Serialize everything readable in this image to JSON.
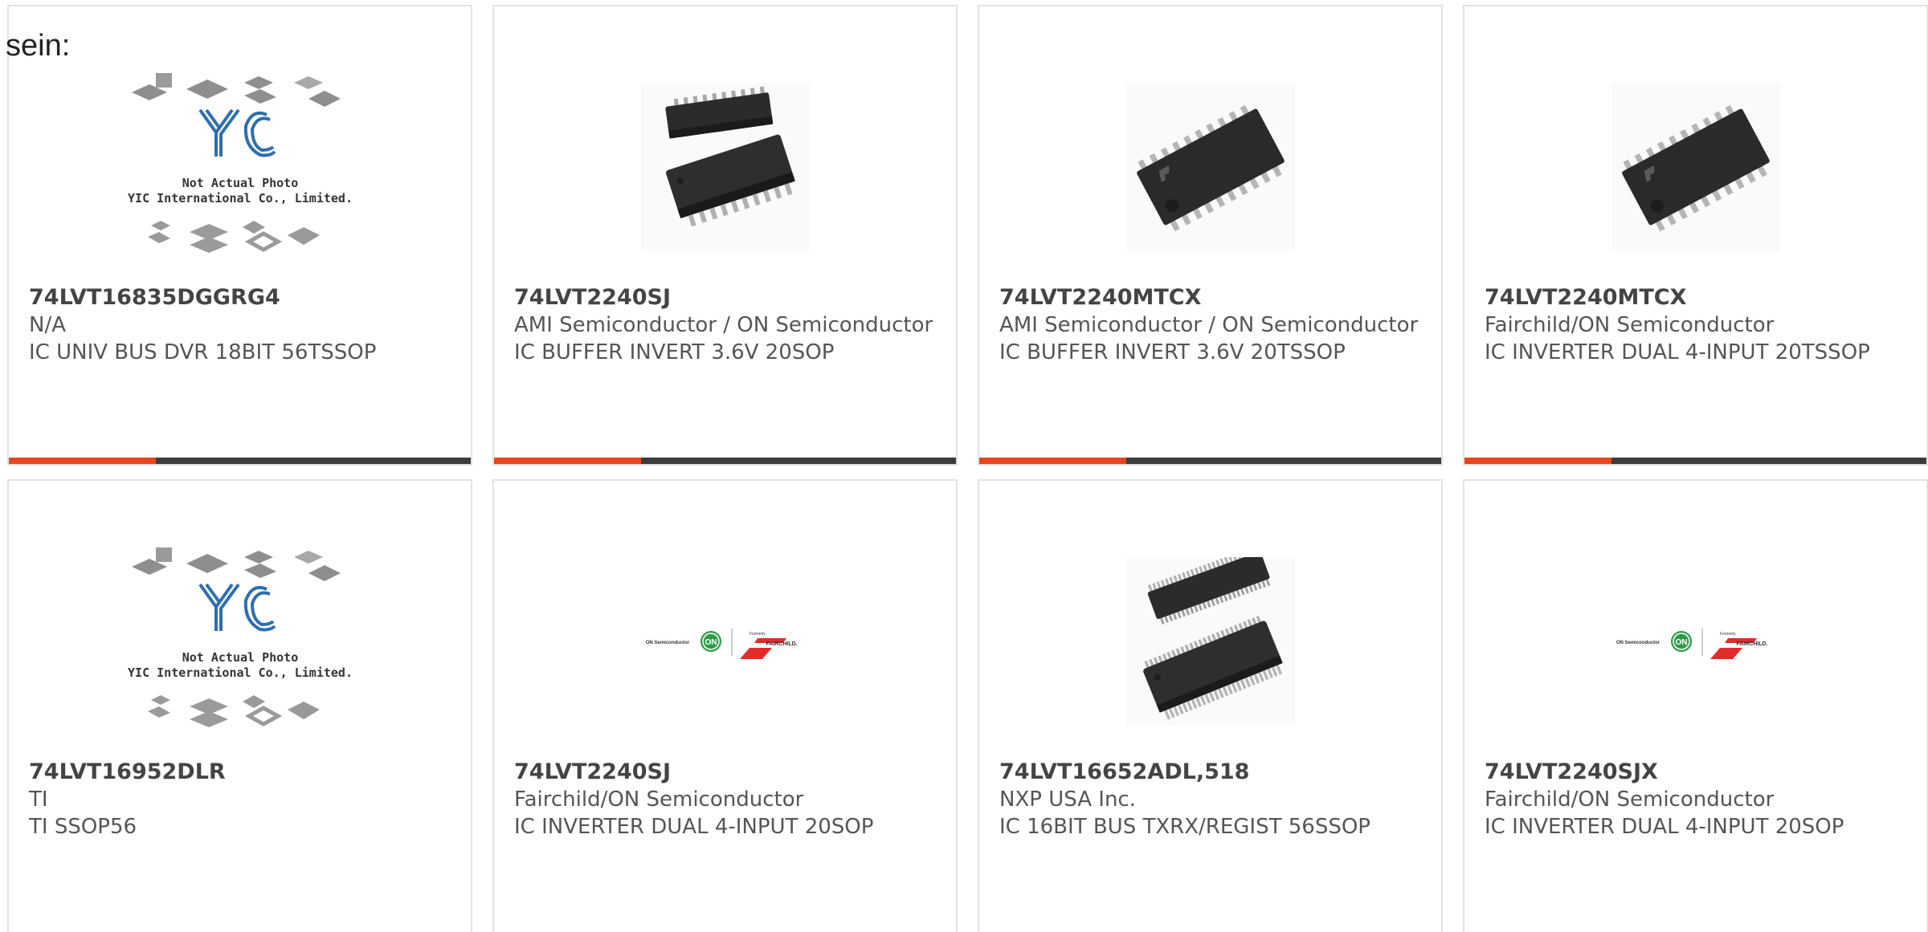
{
  "lead_text": "sein:",
  "placeholder_image": {
    "line1": "Not Actual Photo",
    "line2": "YIC International Co., Limited.",
    "logo": "YIC"
  },
  "logo_image": {
    "left": "ON Semiconductor",
    "middle": "ON",
    "top": "Formerly",
    "right": "FAIRCHILD."
  },
  "colors": {
    "accent": "#e8461e",
    "bar": "#3c3c3c",
    "yic_blue": "#2f6fae",
    "on_green": "#2e9a47",
    "fairchild_red": "#e22b2b"
  },
  "products": [
    {
      "part": "74LVT16835DGGRG4",
      "manufacturer": "N/A",
      "description": "IC UNIV BUS DVR 18BIT 56TSSOP",
      "image": "placeholder"
    },
    {
      "part": "74LVT2240SJ",
      "manufacturer": "AMI Semiconductor / ON Semiconductor",
      "description": "IC BUFFER INVERT 3.6V 20SOP",
      "image": "soic20"
    },
    {
      "part": "74LVT2240MTCX",
      "manufacturer": "AMI Semiconductor / ON Semiconductor",
      "description": "IC BUFFER INVERT 3.6V 20TSSOP",
      "image": "tssop20"
    },
    {
      "part": "74LVT2240MTCX",
      "manufacturer": "Fairchild/ON Semiconductor",
      "description": "IC INVERTER DUAL 4-INPUT 20TSSOP",
      "image": "tssop20"
    },
    {
      "part": "74LVT16952DLR",
      "manufacturer": "TI",
      "description": "TI SSOP56",
      "image": "placeholder"
    },
    {
      "part": "74LVT2240SJ",
      "manufacturer": "Fairchild/ON Semiconductor",
      "description": "IC INVERTER DUAL 4-INPUT 20SOP",
      "image": "logo"
    },
    {
      "part": "74LVT16652ADL,518",
      "manufacturer": "NXP USA Inc.",
      "description": "IC 16BIT BUS TXRX/REGIST 56SSOP",
      "image": "ssop56"
    },
    {
      "part": "74LVT2240SJX",
      "manufacturer": "Fairchild/ON Semiconductor",
      "description": "IC INVERTER DUAL 4-INPUT 20SOP",
      "image": "logo"
    }
  ]
}
